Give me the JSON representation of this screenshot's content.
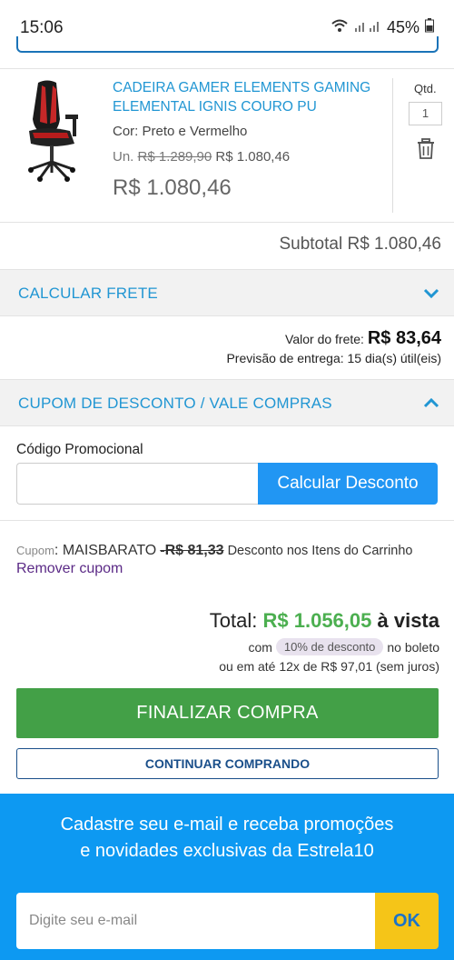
{
  "status_bar": {
    "time": "15:06",
    "battery": "45%"
  },
  "product": {
    "name": "CADEIRA GAMER ELEMENTS GAMING ELEMENTAL IGNIS COURO PU",
    "color": "Cor: Preto e Vermelho",
    "unit_prefix": "Un.",
    "unit_old_price": "R$ 1.289,90",
    "unit_new_price": "R$ 1.080,46",
    "price": "R$ 1.080,46",
    "qty_label": "Qtd.",
    "qty_value": "1"
  },
  "subtotal": "Subtotal R$ 1.080,46",
  "frete": {
    "section_label": "CALCULAR FRETE",
    "value_label": "Valor do frete:",
    "value": "R$ 83,64",
    "forecast": "Previsão de entrega: 15 dia(s) útil(eis)"
  },
  "cupom_section": {
    "section_label": "CUPOM DE DESCONTO / VALE COMPRAS",
    "code_label": "Código Promocional",
    "button_label": "Calcular Desconto",
    "applied_label": "Cupom",
    "applied_code": ": MAISBARATO",
    "applied_discount": "-R$ 81,33",
    "applied_desc": "Desconto nos Itens do Carrinho",
    "remove_label": "Remover cupom"
  },
  "total": {
    "label": "Total:",
    "value": "R$ 1.056,05",
    "suffix": "à vista",
    "boleto_prefix": "com",
    "boleto_badge": "10% de desconto",
    "boleto_suffix": "no boleto",
    "installments": "ou em até 12x de R$ 97,01 (sem juros)"
  },
  "buttons": {
    "finalize": "FINALIZAR COMPRA",
    "continue": "CONTINUAR COMPRANDO"
  },
  "newsletter": {
    "line1": "Cadastre seu e-mail e receba promoções",
    "line2": "e novidades exclusivas da Estrela10",
    "placeholder": "Digite seu e-mail",
    "ok_label": "OK"
  },
  "colors": {
    "accent": "#2196d3",
    "green": "#43a047",
    "newsletter_bg": "#0d99f2",
    "ok_yellow": "#f5c518"
  }
}
